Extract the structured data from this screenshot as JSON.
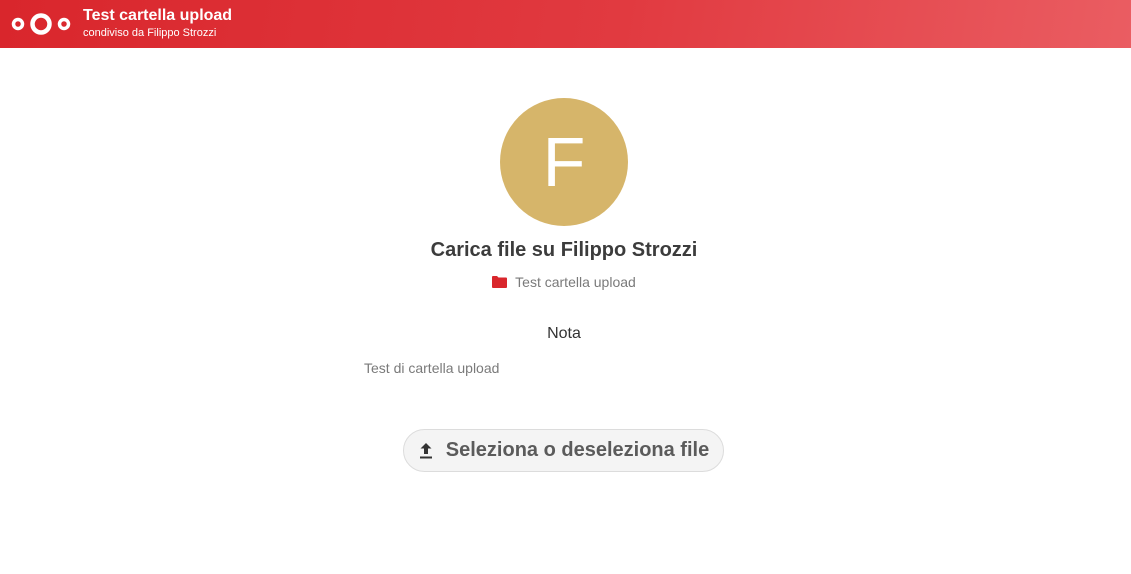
{
  "header": {
    "title": "Test cartella upload",
    "subtitle": "condiviso da Filippo Strozzi",
    "logo_icon": "nextcloud-logo-icon",
    "background_color": "#e13a40"
  },
  "main": {
    "avatar_initial": "F",
    "avatar_color": "#d6b56a",
    "title": "Carica file su Filippo Strozzi",
    "folder_icon": "folder-icon",
    "folder_color": "#d9262c",
    "folder_name": "Test cartella upload",
    "note_title": "Nota",
    "note_text": "Test di cartella upload",
    "upload_icon": "upload-icon",
    "upload_button_label": "Seleziona o deseleziona file"
  }
}
